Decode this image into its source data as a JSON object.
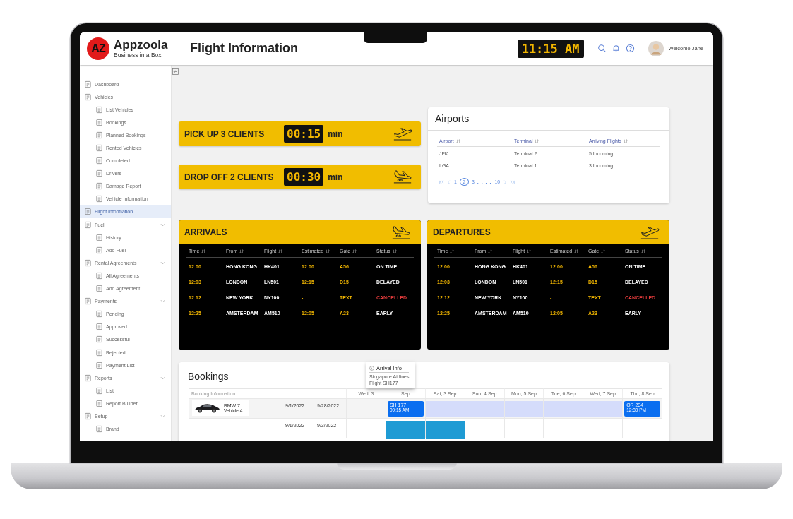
{
  "brand": {
    "logo": "AZ",
    "name": "Appzoola",
    "tagline": "Business in a Box"
  },
  "page_title": "Flight Information",
  "clock": "11:15 AM",
  "user": {
    "greeting": "Welcome Jane"
  },
  "sidebar": {
    "items": [
      {
        "label": "Dashboard",
        "selected": false,
        "collapsible": false
      },
      {
        "label": "Vehicles",
        "selected": false,
        "collapsible": false,
        "children": [
          {
            "label": "List Vehicles",
            "selected": false
          },
          {
            "label": "Bookings",
            "selected": false
          },
          {
            "label": "Planned Bookings",
            "selected": false
          },
          {
            "label": "Rented Vehicles",
            "selected": false
          },
          {
            "label": "Completed",
            "selected": false
          },
          {
            "label": "Drivers",
            "selected": false
          },
          {
            "label": "Damage Report",
            "selected": false
          },
          {
            "label": "Vehicle Information",
            "selected": false
          }
        ]
      },
      {
        "label": "Flight Information",
        "selected": true,
        "collapsible": false
      },
      {
        "label": "Fuel",
        "selected": false,
        "collapsible": true,
        "children": [
          {
            "label": "History",
            "selected": false
          },
          {
            "label": "Add Fuel",
            "selected": false
          }
        ]
      },
      {
        "label": "Rental Agreements",
        "selected": false,
        "collapsible": true,
        "children": [
          {
            "label": "All Agreements",
            "selected": false
          },
          {
            "label": "Add Agreement",
            "selected": false
          }
        ]
      },
      {
        "label": "Payments",
        "selected": false,
        "collapsible": true,
        "children": [
          {
            "label": "Pending",
            "selected": false
          },
          {
            "label": "Approved",
            "selected": false
          },
          {
            "label": "Successful",
            "selected": false
          },
          {
            "label": "Rejected",
            "selected": false
          },
          {
            "label": "Payment List",
            "selected": false
          }
        ]
      },
      {
        "label": "Reports",
        "selected": false,
        "collapsible": true,
        "children": [
          {
            "label": "List",
            "selected": false
          },
          {
            "label": "Report Builder",
            "selected": false
          }
        ]
      },
      {
        "label": "Setup",
        "selected": false,
        "collapsible": true,
        "children": [
          {
            "label": "Brand",
            "selected": false
          }
        ]
      }
    ]
  },
  "timers": [
    {
      "kind": "takeoff",
      "label": "PICK UP 3 CLIENTS",
      "time": "00:15",
      "unit": "min"
    },
    {
      "kind": "landing",
      "label": "DROP OFF 2 CLIENTS",
      "time": "00:30",
      "unit": "min"
    }
  ],
  "airports": {
    "title": "Airports",
    "columns": [
      "Airport",
      "Terminal",
      "Arriving Flights"
    ],
    "rows": [
      [
        "JFK",
        "Terminal 2",
        "5 Incoming"
      ],
      [
        "LGA",
        "Terminal 1",
        "3 Incoming"
      ]
    ],
    "pagination": {
      "pages": [
        {
          "label": "1",
          "selected": false
        },
        {
          "label": "2",
          "selected": true
        },
        {
          "label": "3",
          "selected": false
        }
      ],
      "gap": ". . . .",
      "last": "10"
    }
  },
  "boards": [
    {
      "kind": "landing",
      "title": "ARRIVALS",
      "columns": [
        {
          "label": "Time",
          "accent": true
        },
        {
          "label": "From",
          "accent": false
        },
        {
          "label": "Flight",
          "accent": false
        },
        {
          "label": "Estimated",
          "accent": true
        },
        {
          "label": "Gate",
          "accent": true
        },
        {
          "label": "Status",
          "accent": false
        }
      ],
      "rows": [
        {
          "cells": [
            "12:00",
            "HONG KONG",
            "HK401",
            "12:00",
            "A56",
            "ON TIME"
          ],
          "cancelled": false
        },
        {
          "cells": [
            "12:03",
            "LONDON",
            "LN501",
            "12:15",
            "D15",
            "DELAYED"
          ],
          "cancelled": false
        },
        {
          "cells": [
            "12:12",
            "NEW YORK",
            "NY100",
            "-",
            "TEXT",
            "CANCELLED"
          ],
          "cancelled": true
        },
        {
          "cells": [
            "12:25",
            "AMSTERDAM",
            "AM510",
            "12:05",
            "A23",
            "EARLY"
          ],
          "cancelled": false
        }
      ]
    },
    {
      "kind": "takeoff",
      "title": "DEPARTURES",
      "columns": [
        {
          "label": "Time",
          "accent": true
        },
        {
          "label": "From",
          "accent": false
        },
        {
          "label": "Flight",
          "accent": false
        },
        {
          "label": "Estimated",
          "accent": true
        },
        {
          "label": "Gate",
          "accent": true
        },
        {
          "label": "Status",
          "accent": false
        }
      ],
      "rows": [
        {
          "cells": [
            "12:00",
            "HONG KONG",
            "HK401",
            "12:00",
            "A56",
            "ON TIME"
          ],
          "cancelled": false
        },
        {
          "cells": [
            "12:03",
            "LONDON",
            "LN501",
            "12:15",
            "D15",
            "DELAYED"
          ],
          "cancelled": false
        },
        {
          "cells": [
            "12:12",
            "NEW YORK",
            "NY100",
            "-",
            "TEXT",
            "CANCELLED"
          ],
          "cancelled": true
        },
        {
          "cells": [
            "12:25",
            "AMSTERDAM",
            "AM510",
            "12:05",
            "A23",
            "EARLY"
          ],
          "cancelled": false
        }
      ]
    }
  ],
  "bookings": {
    "title": "Bookings",
    "info_column": "Booking Information",
    "days": [
      "Wed, 3",
      "Sep",
      "Sat, 3 Sep",
      "Sun, 4 Sep",
      "Mon, 5 Sep",
      "Tue, 6 Sep",
      "Wed, 7 Sep",
      "Thu, 8 Sep"
    ],
    "tooltip": {
      "title": "Arrival Info",
      "lines": [
        "Singapore Airlines",
        "Flight SH177"
      ]
    },
    "rows": [
      {
        "vehicle": {
          "kind": "picture",
          "name": "BMW 7",
          "detail": "Vehicle 4"
        },
        "start": "9/1/2022",
        "end": "9/28/2022",
        "cells": [
          {
            "kind": "empty"
          },
          {
            "kind": "flight",
            "label": "SH 177",
            "time": "09:15 AM"
          },
          {
            "kind": "stay"
          },
          {
            "kind": "stay"
          },
          {
            "kind": "stay"
          },
          {
            "kind": "stay"
          },
          {
            "kind": "stay"
          },
          {
            "kind": "flight",
            "label": "OR 234",
            "time": "12:30 PM"
          }
        ]
      },
      {
        "start": "9/1/2022",
        "end": "9/3/2022",
        "cells": [
          {
            "kind": "empty"
          },
          {
            "kind": "block"
          },
          {
            "kind": "block"
          },
          {
            "kind": "empty"
          },
          {
            "kind": "empty"
          },
          {
            "kind": "empty"
          },
          {
            "kind": "empty"
          },
          {
            "kind": "empty"
          }
        ]
      }
    ]
  }
}
